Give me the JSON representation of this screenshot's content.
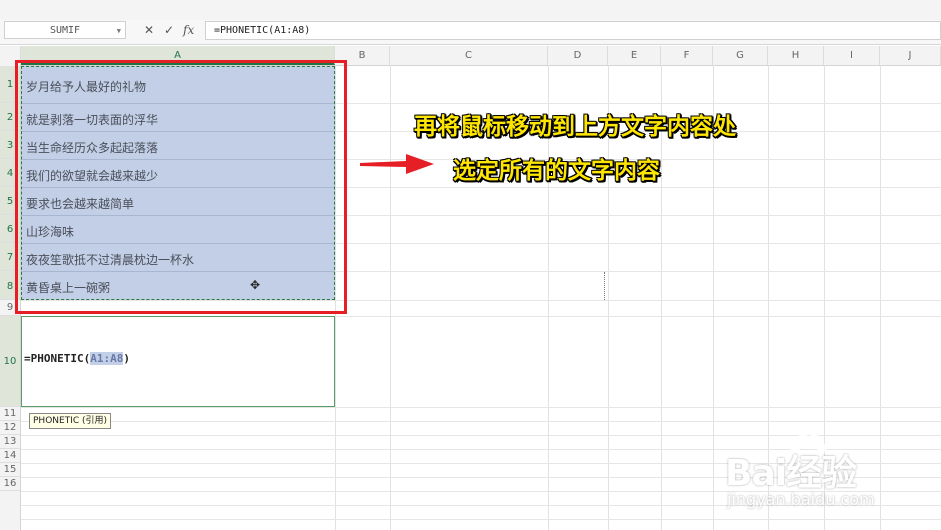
{
  "formula_bar": {
    "name_box": "SUMIF",
    "cancel_icon": "✕",
    "enter_icon": "✓",
    "fx_label": "fx",
    "formula": "=PHONETIC(A1:A8)"
  },
  "columns": [
    "A",
    "B",
    "C",
    "D",
    "E",
    "F",
    "G",
    "H",
    "I",
    "J"
  ],
  "rows": [
    "1",
    "2",
    "3",
    "4",
    "5",
    "6",
    "7",
    "8",
    "9",
    "10",
    "11",
    "12",
    "13",
    "14",
    "15",
    "16"
  ],
  "cells": {
    "A1": "岁月给予人最好的礼物",
    "A2": "就是剥落一切表面的浮华",
    "A3": "当生命经历众多起起落落",
    "A4": "我们的欲望就会越来越少",
    "A5": "要求也会越来越简单",
    "A6": "山珍海味",
    "A7": "夜夜笙歌抵不过清晨枕边一杯水",
    "A8": "黄昏桌上一碗粥"
  },
  "editing": {
    "prefix": "=PHONETIC(",
    "ref": "A1:A8",
    "suffix": ")",
    "tooltip": "PHONETIC (引用)"
  },
  "annotation": {
    "line1": "再将鼠标移动到上方文字内容处",
    "line2": "选定所有的文字内容",
    "arrow_color": "#e61e25",
    "text_color": "#ffe600"
  },
  "watermark": {
    "brand": "Bai经验",
    "url": "jingyan.baidu.com"
  },
  "colors": {
    "selection": "#c2cfe6",
    "highlight_border": "#e61e25",
    "active_header": "#217346"
  }
}
